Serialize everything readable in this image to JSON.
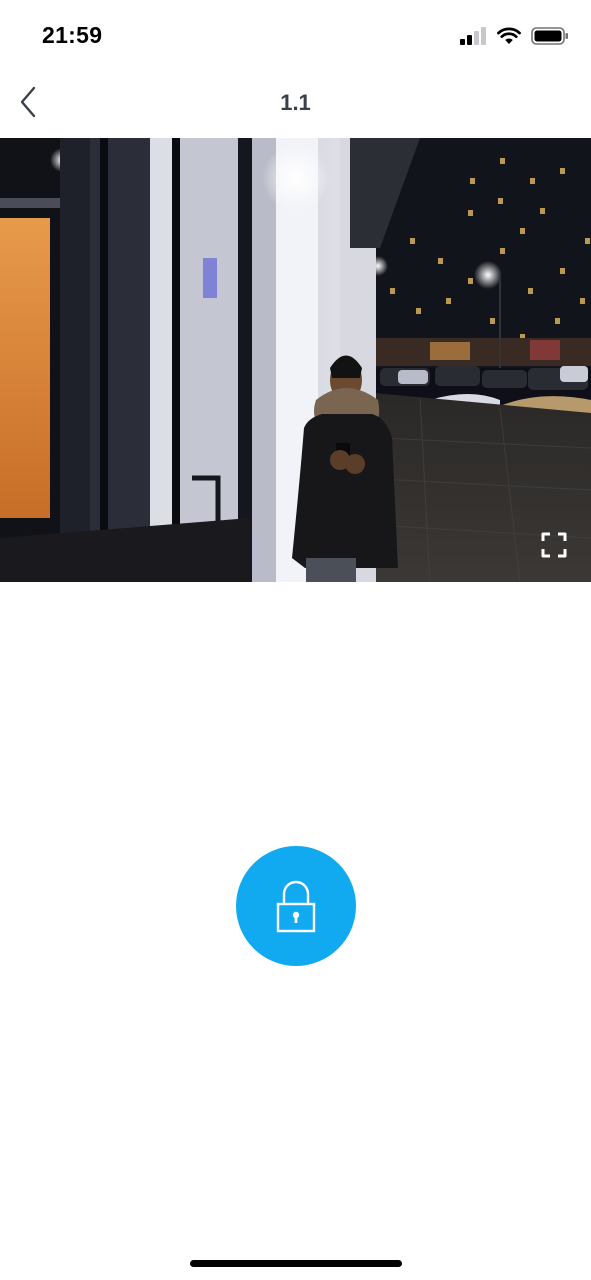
{
  "status_bar": {
    "time": "21:59",
    "icons": [
      "cellular-signal-icon",
      "wifi-icon",
      "battery-icon"
    ]
  },
  "nav": {
    "back_icon": "chevron-left-icon",
    "title": "1.1"
  },
  "camera": {
    "fullscreen_icon": "fullscreen-icon"
  },
  "unlock": {
    "icon": "padlock-icon",
    "color": "#11aaf0"
  }
}
